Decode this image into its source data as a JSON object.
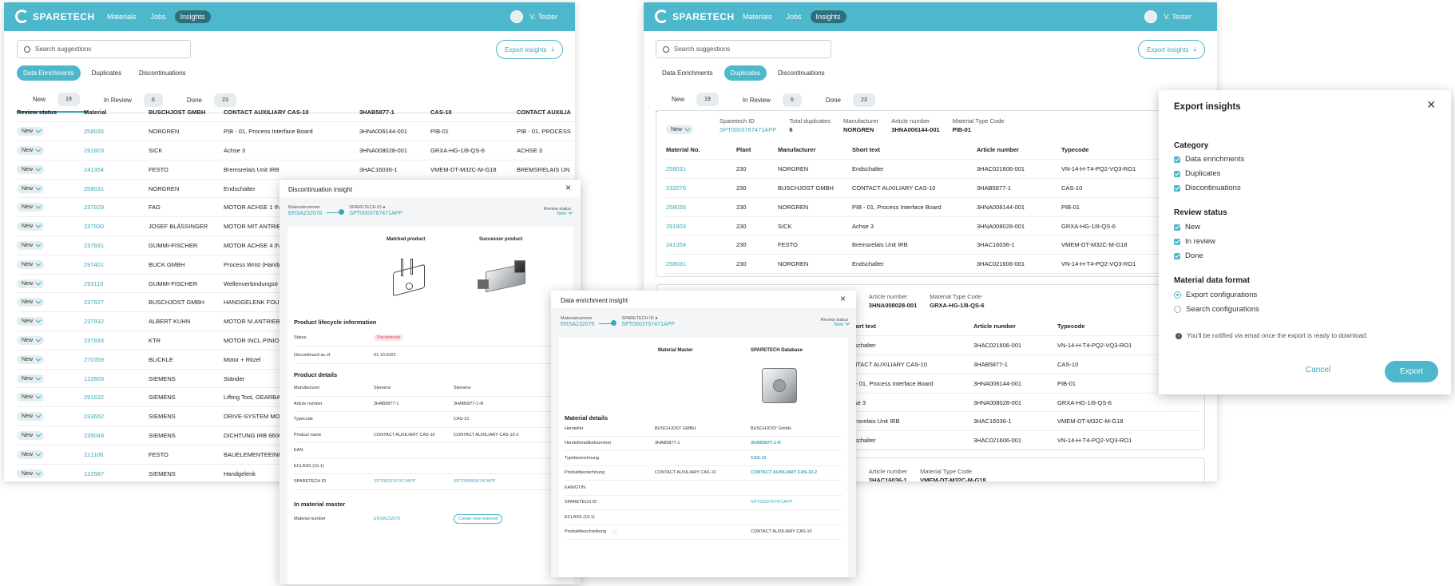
{
  "app": {
    "brand": "SPARETECH",
    "nav": [
      "Materials",
      "Jobs",
      "Insights"
    ],
    "user": "V. Tester"
  },
  "w1": {
    "search_placeholder": "Search suggestions",
    "export_label": "Export insights",
    "tabs": [
      "Data Enrichments",
      "Duplicates",
      "Discontinuations"
    ],
    "subtabs": [
      {
        "label": "New",
        "count": "19"
      },
      {
        "label": "In Review",
        "count": "6"
      },
      {
        "label": "Done",
        "count": "23"
      }
    ],
    "headers": [
      "Review status",
      "Material",
      "BUSCHJOST GMBH",
      "CONTACT AUXILIARY  CAS-10",
      "3HAB5877-1",
      "CAS-10",
      "CONTACT AUXILIA"
    ],
    "rows": [
      [
        "New",
        "258035",
        "NORGREN",
        "PIB - 01, Process Interface Board",
        "3HNA006144-001",
        "PIB-01",
        "PIB - 01, PROCESS"
      ],
      [
        "New",
        "291803",
        "SICK",
        "Achse 3",
        "3HNA008028-001",
        "GRXA-HG-1/8-QS-6",
        "ACHSE 3"
      ],
      [
        "New",
        "241354",
        "FESTO",
        "Bremsrelais Unit IRB",
        "3HAC16036-1",
        "VMEM-DT-M32C-M-G18",
        "BREMSRELAIS UN"
      ],
      [
        "New",
        "258031",
        "NORGREN",
        "Endschalter",
        "",
        "",
        ""
      ],
      [
        "New",
        "237929",
        "FAG",
        "MOTOR ACHSE 1 INC",
        "",
        "",
        ""
      ],
      [
        "New",
        "237930",
        "JOSEF BLÄSSINGER",
        "MOTOR MIT ANTRIEB",
        "",
        "",
        ""
      ],
      [
        "New",
        "237931",
        "GUMMI-FISCHER",
        "MOTOR ACHSE 4 INC",
        "",
        "",
        ""
      ],
      [
        "New",
        "297401",
        "BUCK GMBH",
        "Process Wrist (Handg",
        "",
        "",
        ""
      ],
      [
        "New",
        "293115",
        "GUMMI-FISCHER",
        "Wellenverbindungsö",
        "",
        "",
        ""
      ],
      [
        "New",
        "237927",
        "BUSCHJOST GMBH",
        "HANDGELENK FOUNI",
        "",
        "",
        ""
      ],
      [
        "New",
        "237932",
        "ALBERT KUHN",
        "MOTOR M.ANTRIEBS",
        "",
        "",
        ""
      ],
      [
        "New",
        "237933",
        "KTR",
        "MOTOR INCL.PINION",
        "",
        "",
        ""
      ],
      [
        "New",
        "270359",
        "BLICKLE",
        "Motor + Ritzel",
        "",
        "",
        ""
      ],
      [
        "New",
        "122609",
        "SIEMENS",
        "Ständer",
        "",
        "",
        ""
      ],
      [
        "New",
        "291632",
        "SIEMENS",
        "Lifting Tool, GEARBA",
        "",
        "",
        ""
      ],
      [
        "New",
        "233652",
        "SIEMENS",
        "DRIVE-SYSTEM MODU",
        "",
        "",
        ""
      ],
      [
        "New",
        "235049",
        "SIEMENS",
        "DICHTUNG  IRB 6600",
        "",
        "",
        ""
      ],
      [
        "New",
        "221106",
        "FESTO",
        "BAUELEMENTEEINHE",
        "",
        "",
        ""
      ],
      [
        "New",
        "122587",
        "SIEMENS",
        "Handgelenk",
        "",
        "",
        ""
      ]
    ]
  },
  "disc": {
    "title": "Discontinuation insight",
    "mat_label": "Materialnummer",
    "mat_value": "ERSA232076",
    "st_label": "SPARETECH ID",
    "st_value": "SPT0003767471APP",
    "rs_label": "Review status",
    "rs_value": "New",
    "matched": "Matched product",
    "successor": "Successor product",
    "lifecycle_title": "Product lifecycle information",
    "status_label": "Status",
    "status_value": "Discontinued",
    "disc_label": "Discontinued as of",
    "disc_value": "01.10.2022",
    "details_title": "Product details",
    "rows": [
      [
        "Manufacturer",
        "Siemens",
        "Siemens"
      ],
      [
        "Article number",
        "3HAB5877-1",
        "3HAB5877-1-R"
      ],
      [
        "Typecode",
        "",
        "CAS-10"
      ],
      [
        "Product name",
        "CONTACT AUXILIARY  CAS-10",
        "CONTACT AUXILIARY  CAS-10-2"
      ],
      [
        "EAN",
        "",
        ""
      ],
      [
        "ECLASS (10.1)",
        "",
        ""
      ],
      [
        "SPARETECH ID",
        "SPT0003767471APP",
        "SPT0005656747APP"
      ]
    ],
    "master_title": "In material master",
    "mn_label": "Material number",
    "mn_value": "ERSA232076",
    "create_label": "Create new material"
  },
  "enr": {
    "title": "Data enrichment insight",
    "mat_label": "Materialnummer",
    "mat_value": "ERSA232076",
    "st_label": "SPARETECH ID",
    "st_value": "SPT0003767471APP",
    "rs_label": "Review status",
    "rs_value": "New",
    "col_master": "Material Master",
    "col_db": "SPARETECH Database",
    "section": "Material details",
    "rows": [
      [
        "Hersteller",
        "BUSCHJOST GMBH",
        "BUSCHJOST GmbH"
      ],
      [
        "Herstellerartikelnummer",
        "3HAB5877-1",
        "3HAB5877-1-R"
      ],
      [
        "Typebezeichnung",
        "",
        "CAS-10"
      ],
      [
        "Produktbezeichnung",
        "CONTACT AUXILIARY  CAS-10",
        "CONTACT AUXILIARY  CAS-10-2"
      ],
      [
        "EAN/GTIN",
        "",
        ""
      ],
      [
        "SPARETECH ID",
        "",
        "SPT0003767471APP"
      ],
      [
        "ECLASS (10.1)",
        "",
        ""
      ],
      [
        "Produktbeschreibung",
        "",
        "CONTACT AUXILIARY  CAS-10"
      ]
    ]
  },
  "w2": {
    "search_placeholder": "Search suggestions",
    "export_label": "Export insights",
    "tabs": [
      "Data Enrichments",
      "Duplicates",
      "Discontinuations"
    ],
    "subtabs": [
      {
        "label": "New",
        "count": "19"
      },
      {
        "label": "In Review",
        "count": "6"
      },
      {
        "label": "Done",
        "count": "23"
      }
    ],
    "card1": {
      "status": "New",
      "meta": [
        {
          "label": "Sparetech ID",
          "value": "SPT0003767471APP"
        },
        {
          "label": "Total duplicates",
          "value": "6"
        },
        {
          "label": "Manufacturer",
          "value": "NORGREN"
        },
        {
          "label": "Article number",
          "value": "3HNA006144-001"
        },
        {
          "label": "Material Type Code",
          "value": "PIB-01"
        }
      ],
      "headers": [
        "Material No.",
        "Plant",
        "Manufacturer",
        "Short text",
        "Article number",
        "Typecode"
      ],
      "rows": [
        [
          "258031",
          "230",
          "NORGREN",
          "Endschalter",
          "3HAC021606-001",
          "VN-14-H-T4-PQ2-VQ3-RO1"
        ],
        [
          "232076",
          "230",
          "BUSCHJOST GMBH",
          "CONTACT AUXILIARY  CAS-10",
          "3HAB5877-1",
          "CAS-10"
        ],
        [
          "258035",
          "230",
          "NORGREN",
          "PIB - 01, Process Interface Board",
          "3HNA006144-001",
          "PIB-01"
        ],
        [
          "291803",
          "230",
          "SICK",
          "Achse 3",
          "3HNA008028-001",
          "GRXA-HG-1/8-QS-6"
        ],
        [
          "241354",
          "230",
          "FESTO",
          "Bremsrelais Unit IRB",
          "3HAC16036-1",
          "VMEM-DT-M32C-M-G18"
        ],
        [
          "258031",
          "230",
          "NORGREN",
          "Endschalter",
          "3HAC021606-001",
          "VN-14-H-T4-PQ2-VQ3-RO1"
        ]
      ]
    },
    "card2": {
      "meta": [
        {
          "label": "nufacturer",
          "value": ""
        },
        {
          "label": "Article number",
          "value": "3HNA008028-001"
        },
        {
          "label": "Material Type Code",
          "value": "GRXA-HG-1/8-QS-6"
        }
      ],
      "headers": [
        "Short text",
        "Article number",
        "Typecode"
      ],
      "rows": [
        [
          "ndschalter",
          "3HAC021606-001",
          "VN-14-H-T4-PQ2-VQ3-RO1"
        ],
        [
          "ONTACT AUXILIARY  CAS-10",
          "3HAB5877-1",
          "CAS-10"
        ],
        [
          "IB - 01, Process Interface Board",
          "3HNA006144-001",
          "PIB-01"
        ],
        [
          "chse 3",
          "3HNA008028-001",
          "GRXA-HG-1/8-QS-6"
        ],
        [
          "remsrelais Unit IRB",
          "3HAC16036-1",
          "VMEM-DT-M32C-M-G18"
        ],
        [
          "ndschalter",
          "3HAC021606-001",
          "VN-14-H-T4-PQ2-VQ3-RO1"
        ]
      ]
    },
    "card3": {
      "meta": [
        {
          "label": "nufacturer",
          "value": ""
        },
        {
          "label": "Article number",
          "value": "3HAC16036-1"
        },
        {
          "label": "Material Type Code",
          "value": "VMEM-DT-M32C-M-G18"
        }
      ]
    }
  },
  "export": {
    "title": "Export insights",
    "category_title": "Category",
    "categories": [
      "Data enrichments",
      "Duplicates",
      "Discontinuations"
    ],
    "review_title": "Review status",
    "reviews": [
      "New",
      "In review",
      "Done"
    ],
    "format_title": "Material data format",
    "formats": [
      "Export configurations",
      "Search configurations"
    ],
    "info": "You'll be notified via email once the export is ready to download.",
    "cancel": "Cancel",
    "export": "Export"
  }
}
